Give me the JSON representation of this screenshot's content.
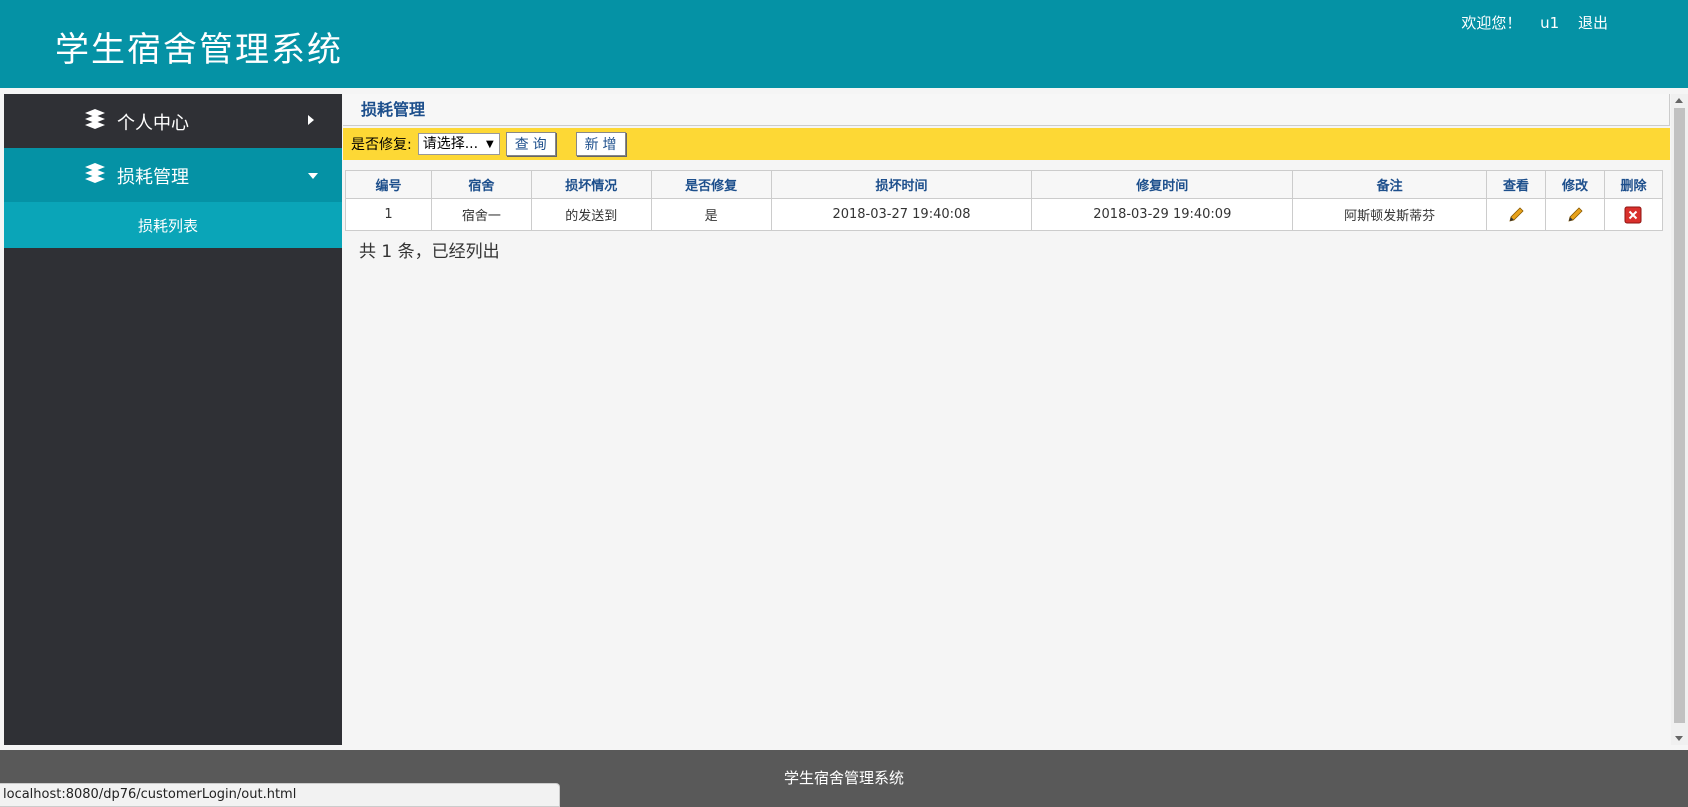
{
  "header": {
    "title": "学生宿舍管理系统",
    "welcome": "欢迎您！",
    "username": "u1",
    "logout": "退出"
  },
  "sidebar": {
    "items": [
      {
        "label": "个人中心",
        "icon": "stack-icon",
        "state": "collapsed"
      },
      {
        "label": "损耗管理",
        "icon": "stack-icon",
        "state": "expanded"
      }
    ],
    "subitems": [
      {
        "label": "损耗列表"
      }
    ]
  },
  "main": {
    "breadcrumb": "损耗管理",
    "filter": {
      "label": "是否修复:",
      "selected": "请选择...",
      "query_button": "查 询",
      "add_button": "新 增"
    },
    "table": {
      "headers": [
        "编号",
        "宿舍",
        "损坏情况",
        "是否修复",
        "损坏时间",
        "修复时间",
        "备注",
        "查看",
        "修改",
        "删除"
      ],
      "rows": [
        {
          "id": "1",
          "dorm": "宿舍一",
          "damage": "的发送到",
          "repaired": "是",
          "damage_time": "2018-03-27 19:40:08",
          "repair_time": "2018-03-29 19:40:09",
          "note": "阿斯顿发斯蒂芬"
        }
      ]
    },
    "summary": "共 1 条，已经列出"
  },
  "footer": {
    "text": "学生宿舍管理系统"
  },
  "status_bar": {
    "url": "localhost:8080/dp76/customerLogin/out.html"
  },
  "colors": {
    "header_bg": "#0592a5",
    "sidebar_bg": "#2f3035",
    "toolbar_bg": "#fdd835",
    "link_blue": "#1d4f8c",
    "footer_bg": "#595959"
  }
}
